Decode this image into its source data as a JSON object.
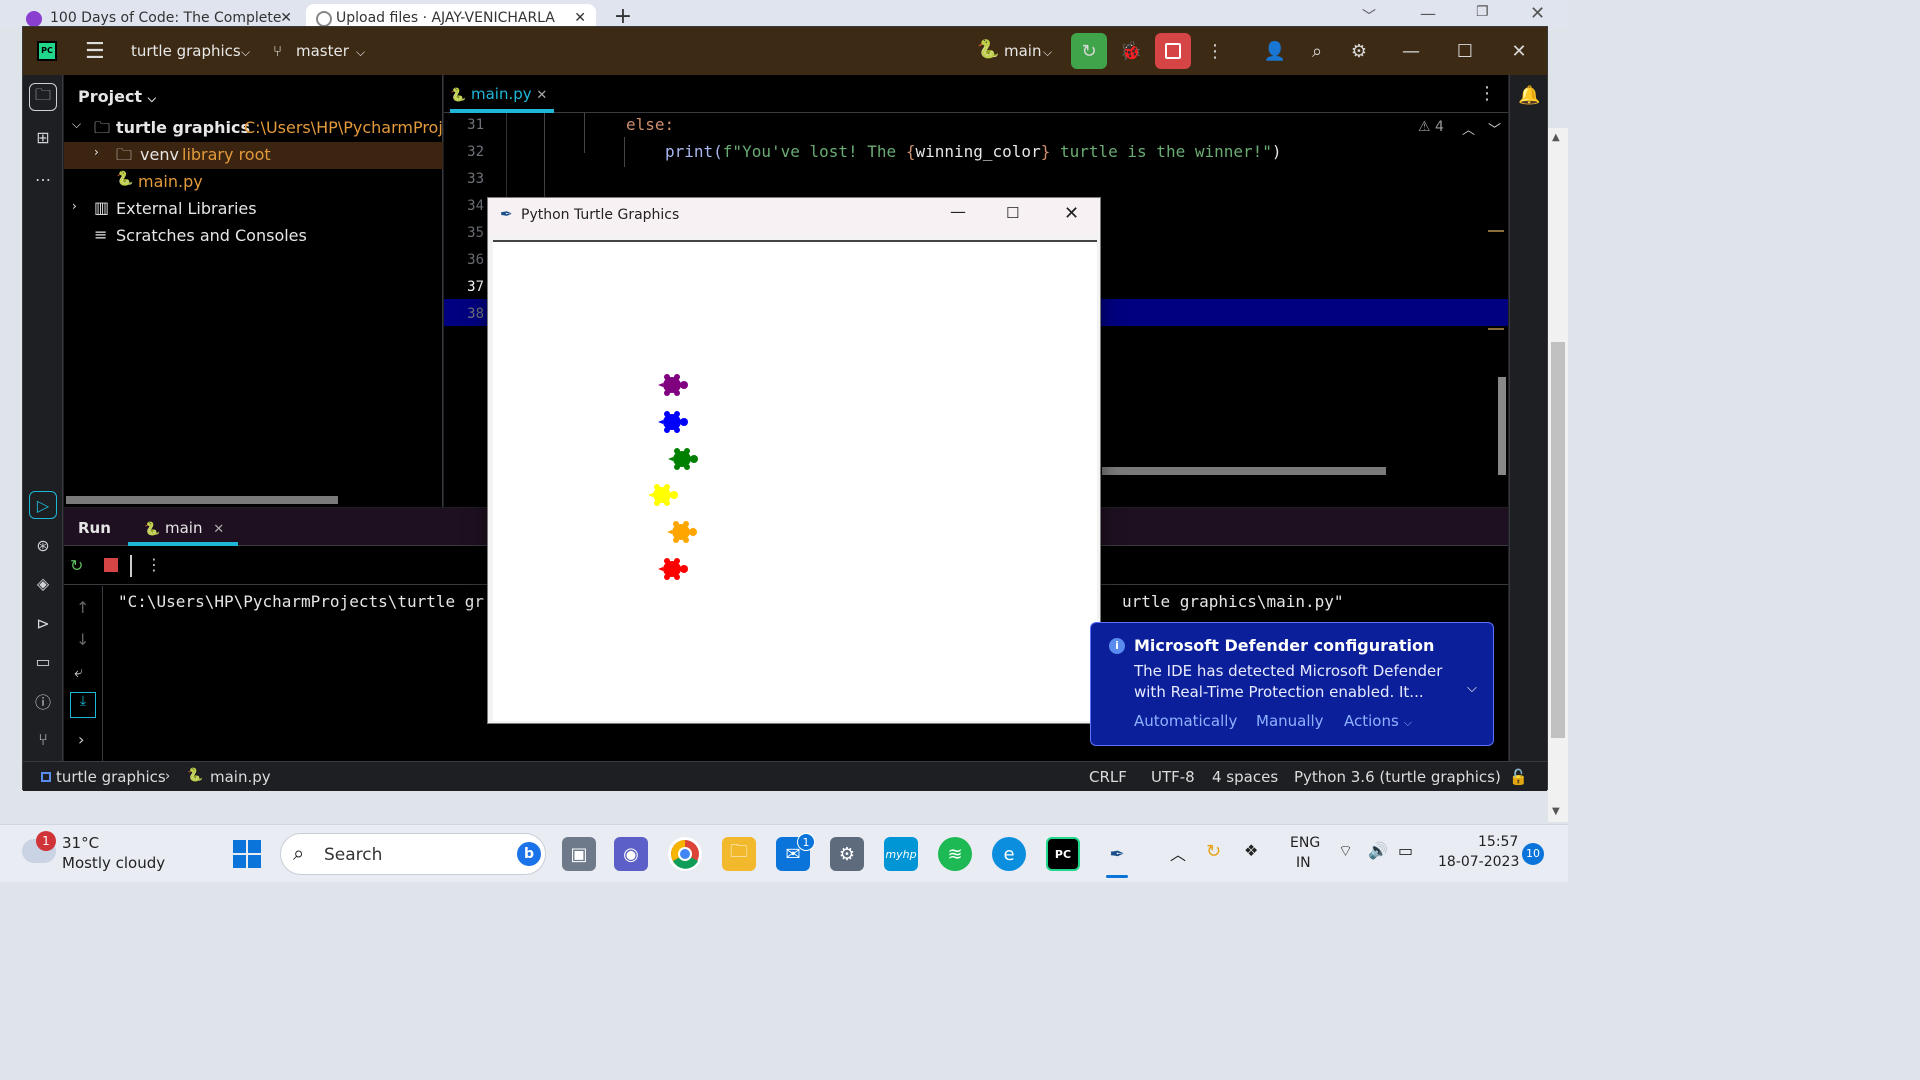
{
  "browser": {
    "tabs": [
      {
        "title": "100 Days of Code: The Complete"
      },
      {
        "title": "Upload files · AJAY-VENICHARLA"
      }
    ]
  },
  "ide": {
    "project_name": "turtle graphics",
    "branch": "master",
    "run_config": "main",
    "project_pane": {
      "title": "Project",
      "root_label": "turtle graphics",
      "root_path": "C:\\Users\\HP\\PycharmProje",
      "venv_label": "venv",
      "venv_hint": "library root",
      "file_label": "main.py",
      "external_libraries": "External Libraries",
      "scratches": "Scratches and Consoles"
    },
    "editor": {
      "tab_label": "main.py",
      "warnings_count": "4",
      "line_numbers": [
        "31",
        "32",
        "33",
        "34",
        "35",
        "36",
        "37",
        "38"
      ],
      "code_line_31": "else:",
      "code_line_32_a": "print(",
      "code_line_32_b": "f\"You've lost! The ",
      "code_line_32_c": "{",
      "code_line_32_d": "winning_color",
      "code_line_32_e": "}",
      "code_line_32_f": " turtle is the winner!\"",
      "code_line_32_g": ")"
    },
    "run_pane": {
      "tab_run": "Run",
      "tab_main": "main",
      "output_left": "\"C:\\Users\\HP\\PycharmProjects\\turtle gr",
      "output_right": "urtle graphics\\main.py\""
    },
    "statusbar": {
      "crumb_project": "turtle graphics",
      "crumb_file": "main.py",
      "line_sep": "CRLF",
      "encoding": "UTF-8",
      "indent": "4 spaces",
      "interpreter": "Python 3.6 (turtle graphics)"
    }
  },
  "turtle_window": {
    "title": "Python Turtle Graphics",
    "turtles": [
      "purple",
      "blue",
      "green",
      "yellow",
      "orange",
      "red"
    ]
  },
  "notification": {
    "title": "Microsoft Defender configuration",
    "body": "The IDE has detected Microsoft Defender with Real-Time Protection enabled. It...",
    "action_1": "Automatically",
    "action_2": "Manually",
    "action_3": "Actions"
  },
  "taskbar": {
    "weather_temp": "31°C",
    "weather_desc": "Mostly cloudy",
    "weather_badge": "1",
    "search_placeholder": "Search",
    "mail_badge": "1",
    "lang_1": "ENG",
    "lang_2": "IN",
    "time": "15:57",
    "date": "18-07-2023",
    "notif_count": "10"
  },
  "colors": {
    "titlebar": "#3c2a14",
    "accent_cyan": "#1fb7d8",
    "run_green": "#3fa44a",
    "stop_red": "#d64545",
    "selection_blue": "#000080",
    "notification_blue": "#0b1f9a"
  }
}
